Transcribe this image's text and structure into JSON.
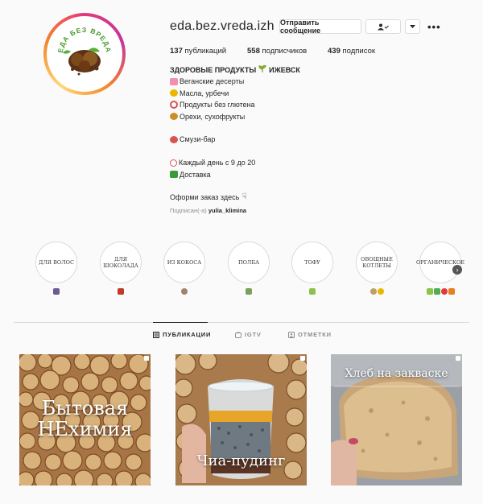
{
  "profile": {
    "username": "eda.bez.vreda.izh",
    "avatar_text": "ЕДА БЕЗ ВРЕДА",
    "message_button": "Отправить сообщение",
    "follow_icon": "person-check-icon",
    "dropdown_icon": "chevron-down-icon",
    "more_icon": "ellipsis-icon"
  },
  "stats": {
    "posts_count": "137",
    "posts_label": " публикаций",
    "followers_count": "558",
    "followers_label": " подписчиков",
    "following_count": "439",
    "following_label": " подписок"
  },
  "bio": {
    "title": "ЗДОРОВЫЕ ПРОДУКТЫ",
    "city": "ИЖЕВСК",
    "items": [
      "Веганские десерты",
      "Масла, урбечи",
      "Продукты без глютена",
      "Орехи, сухофрукты"
    ],
    "smoothie": "Смузи-бар",
    "hours": "Каждый день с 9 до 20",
    "delivery": "Доставка",
    "order": "Оформи заказ здесь",
    "subscribed_prefix": "Подписан(-а)",
    "subscribed_user": "yulia_klimina"
  },
  "highlights": [
    {
      "label": "ДЛЯ ВОЛОС",
      "emoji": [
        "#6b5b95"
      ]
    },
    {
      "label": "ДЛЯ ШОКОЛАДА",
      "emoji": [
        "#c0392b"
      ]
    },
    {
      "label": "ИЗ КОКОСА",
      "emoji": [
        "#a0826d"
      ]
    },
    {
      "label": "ПОЛБА",
      "emoji": [
        "#7ba05b"
      ]
    },
    {
      "label": "ТОФУ",
      "emoji": [
        "#8bc34a"
      ]
    },
    {
      "label": "ОВОЩНЫЕ КОТЛЕТЫ",
      "emoji": [
        "#c0a060",
        "#e6b800"
      ]
    },
    {
      "label": "ОРГАНИЧЕСКОЕ",
      "emoji": [
        "#8bc34a",
        "#4caf50",
        "#e53935",
        "#e67e22"
      ]
    }
  ],
  "tabs": {
    "posts": "ПУБЛИКАЦИИ",
    "igtv": "IGTV",
    "tagged": "ОТМЕТКИ"
  },
  "posts": [
    {
      "text_line1": "Бытовая",
      "text_line2": "НЕхимия"
    },
    {
      "text_line1": "Чиа-пудинг"
    },
    {
      "text_line1": "Хлеб на закваске"
    }
  ],
  "colors": {
    "accent_ring": "#e23a7a",
    "border": "#dbdbdb",
    "muted": "#8e8e8e"
  }
}
